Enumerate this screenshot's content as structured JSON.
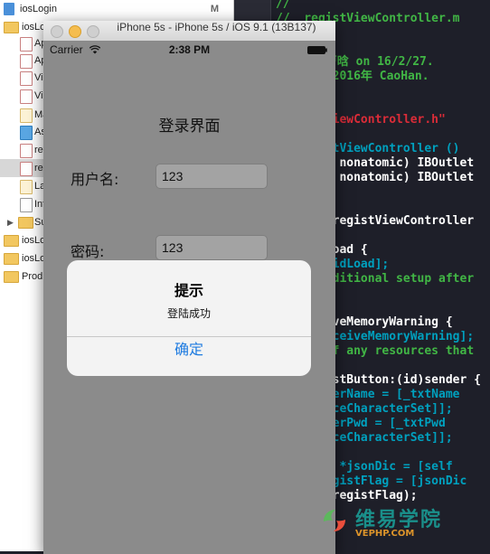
{
  "navigator": {
    "items": [
      {
        "label": "iosLogin",
        "badge": "M",
        "kind": "project"
      },
      {
        "label": "iosLogin",
        "badge": "",
        "kind": "group"
      },
      {
        "label": "Ap",
        "badge": "",
        "kind": "h"
      },
      {
        "label": "Ap",
        "badge": "",
        "kind": "m"
      },
      {
        "label": "Vie",
        "badge": "",
        "kind": "h"
      },
      {
        "label": "Vie",
        "badge": "",
        "kind": "m"
      },
      {
        "label": "Ma",
        "badge": "",
        "kind": "storyboard"
      },
      {
        "label": "As",
        "badge": "",
        "kind": "assets"
      },
      {
        "label": "reg",
        "badge": "",
        "kind": "h"
      },
      {
        "label": "reg",
        "badge": "",
        "kind": "m"
      },
      {
        "label": "La",
        "badge": "",
        "kind": "storyboard"
      },
      {
        "label": "Inf",
        "badge": "",
        "kind": "plist"
      },
      {
        "label": "Su",
        "badge": "",
        "kind": "group"
      },
      {
        "label": "iosLo",
        "badge": "",
        "kind": "group"
      },
      {
        "label": "iosLo",
        "badge": "",
        "kind": "group"
      },
      {
        "label": "Prod",
        "badge": "",
        "kind": "group"
      }
    ]
  },
  "editor": {
    "lines": [
      {
        "text": "//",
        "style": "c-comment"
      },
      {
        "text": "//  registViewController.m",
        "style": "c-comment"
      },
      {
        "text": "Login",
        "style": "c-comment"
      },
      {
        "text": "",
        "style": "c-plain"
      },
      {
        "text": "ted by 曹晗 on 16/2/27.",
        "style": "c-comment"
      },
      {
        "text": "right © 2016年 CaoHan.",
        "style": "c-comment"
      },
      {
        "text": "",
        "style": "c-plain"
      },
      {
        "text": "",
        "style": "c-plain"
      },
      {
        "text": "\"registViewController.h\"",
        "style": "c-string"
      },
      {
        "text": "",
        "style": "c-plain"
      },
      {
        "text": "ce registViewController ()",
        "style": "c-class"
      },
      {
        "text": "y (weak, nonatomic) IBOutlet",
        "style": "c-plain"
      },
      {
        "text": "y (weak, nonatomic) IBOutlet",
        "style": "c-plain"
      },
      {
        "text": "",
        "style": "c-plain"
      },
      {
        "text": "",
        "style": "c-plain"
      },
      {
        "text": "ntation registViewController",
        "style": "c-plain"
      },
      {
        "text": "",
        "style": "c-plain"
      },
      {
        "text": "viewDidLoad {",
        "style": "c-plain"
      },
      {
        "text": "er viewDidLoad];",
        "style": "c-class"
      },
      {
        "text": "o any additional setup after",
        "style": "c-comment"
      },
      {
        "text": "",
        "style": "c-plain"
      },
      {
        "text": "",
        "style": "c-plain"
      },
      {
        "text": "didReceiveMemoryWarning {",
        "style": "c-plain"
      },
      {
        "text": "er didReceiveMemoryWarning];",
        "style": "c-class"
      },
      {
        "text": "ispose of any resources that",
        "style": "c-comment"
      },
      {
        "text": "",
        "style": "c-plain"
      },
      {
        "text": "ion)registButton:(id)sender {",
        "style": "c-plain"
      },
      {
        "text": "ring *userName = [_txtName",
        "style": "c-class"
      },
      {
        "text": "whitespaceCharacterSet]];",
        "style": "c-class"
      },
      {
        "text": "ring *userPwd = [_txtPwd",
        "style": "c-class"
      },
      {
        "text": "whitespaceCharacterSet]];",
        "style": "c-class"
      },
      {
        "text": "",
        "style": "c-plain"
      },
      {
        "text": "ctionary *jsonDic = [self",
        "style": "c-class"
      },
      {
        "text": "ring* registFlag = [jsonDic",
        "style": "c-class"
      },
      {
        "text": "g(@\"%@\",registFlag);",
        "style": "c-plain"
      }
    ]
  },
  "simulator": {
    "window_title": "iPhone 5s - iPhone 5s / iOS 9.1 (13B137)",
    "status": {
      "carrier": "Carrier",
      "time": "2:38 PM"
    },
    "screen": {
      "title": "登录界面",
      "username_label": "用户名:",
      "username_value": "123",
      "password_label": "密码:",
      "password_value": "123"
    },
    "alert": {
      "title": "提示",
      "message": "登陆成功",
      "ok_label": "确定"
    }
  },
  "watermark": {
    "text": "维易学院",
    "sub": "VEPHP.COM"
  },
  "colors": {
    "alert_button": "#1e7be0",
    "editor_bg": "#1e1f29",
    "comment": "#41b645"
  }
}
